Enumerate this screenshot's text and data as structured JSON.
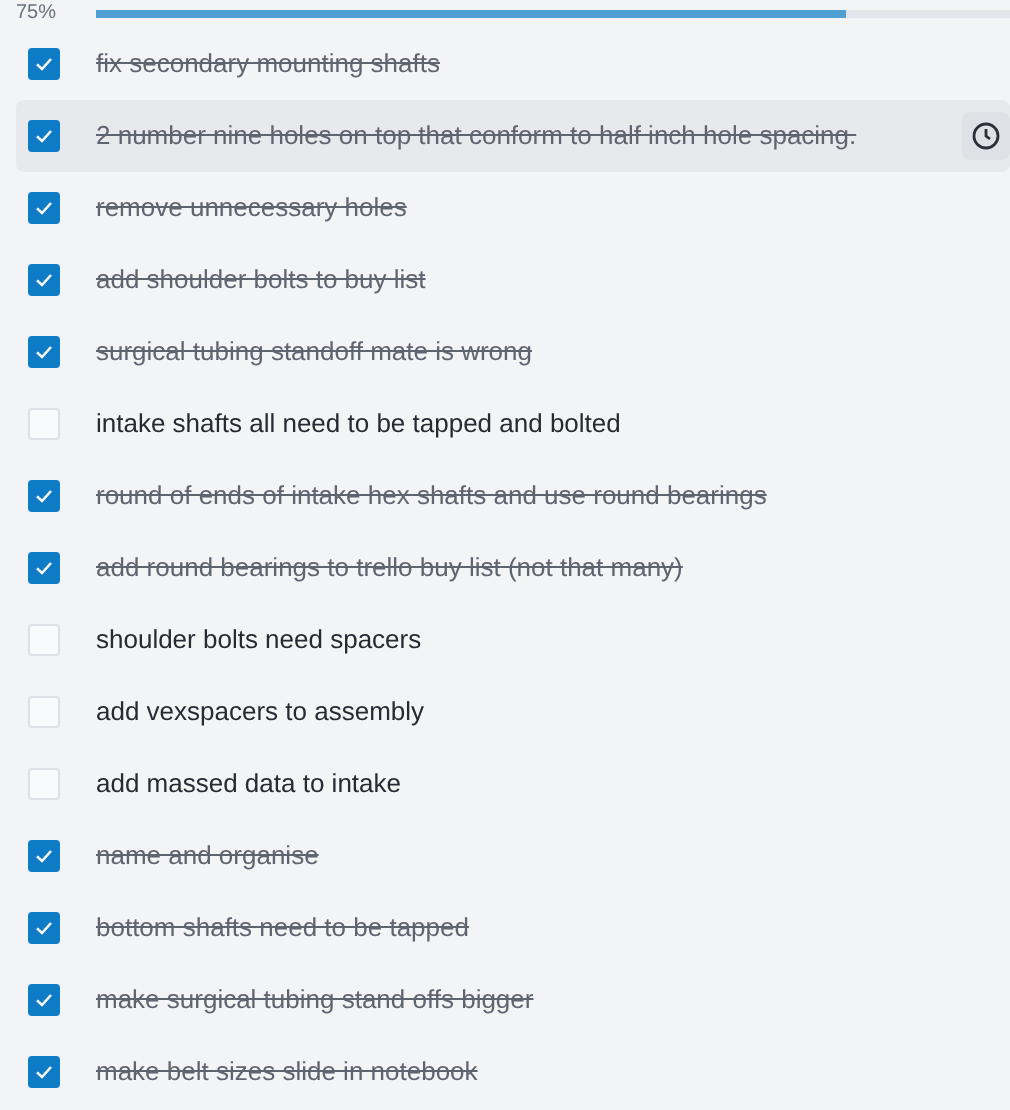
{
  "progress": {
    "label": "75%",
    "level": 0.82
  },
  "tasks": [
    {
      "text": "fix secondary mounting shafts",
      "checked": true,
      "selected": false
    },
    {
      "text": "2 number nine holes on top that conform to half inch hole spacing.",
      "checked": true,
      "selected": true
    },
    {
      "text": "remove unnecessary holes",
      "checked": true,
      "selected": false
    },
    {
      "text": "add shoulder bolts to buy list",
      "checked": true,
      "selected": false
    },
    {
      "text": "surgical tubing standoff mate is wrong",
      "checked": true,
      "selected": false
    },
    {
      "text": "intake shafts all need to be tapped and bolted",
      "checked": false,
      "selected": false
    },
    {
      "text": "round of ends of intake hex shafts and use round bearings",
      "checked": true,
      "selected": false
    },
    {
      "text": "add round bearings to trello buy list (not that many)",
      "checked": true,
      "selected": false
    },
    {
      "text": "shoulder bolts need spacers",
      "checked": false,
      "selected": false
    },
    {
      "text": "add vexspacers to assembly",
      "checked": false,
      "selected": false
    },
    {
      "text": "add massed data to intake",
      "checked": false,
      "selected": false
    },
    {
      "text": "name and organise",
      "checked": true,
      "selected": false
    },
    {
      "text": "bottom shafts need to be tapped",
      "checked": true,
      "selected": false
    },
    {
      "text": "make surgical tubing stand offs bigger",
      "checked": true,
      "selected": false
    },
    {
      "text": "make belt sizes slide in notebook",
      "checked": true,
      "selected": false
    }
  ]
}
